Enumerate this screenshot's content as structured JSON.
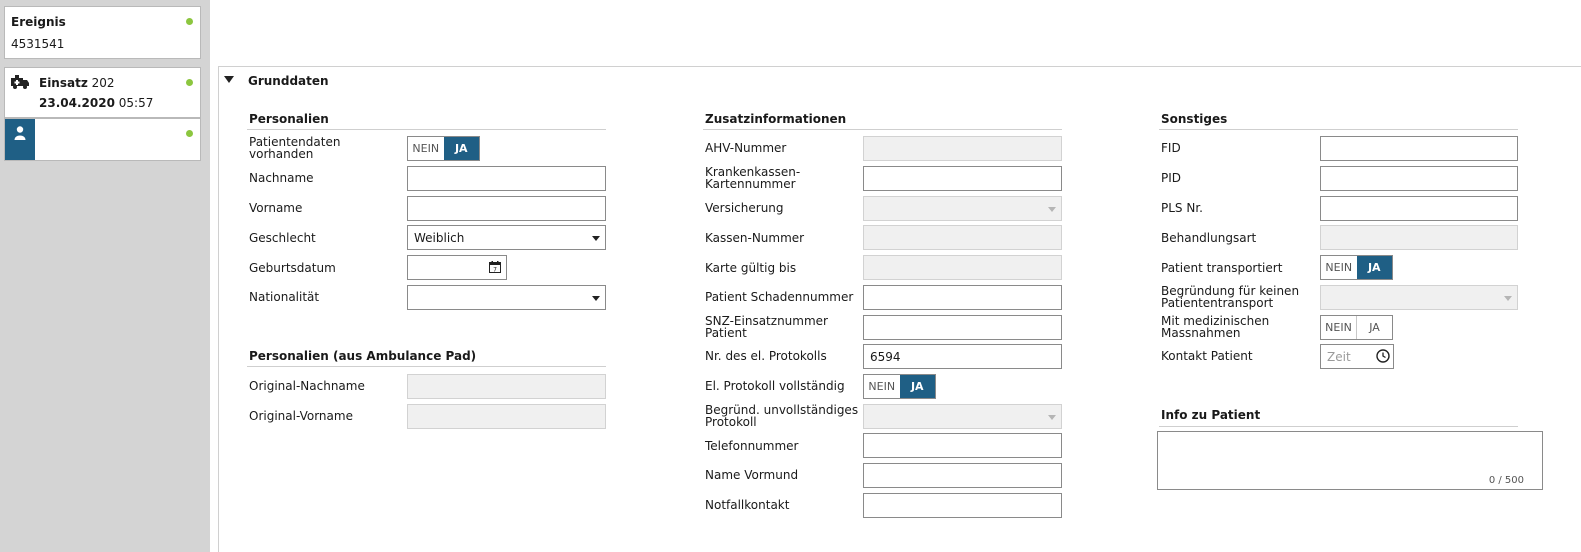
{
  "sidebar": {
    "ereignis": {
      "title": "Ereignis",
      "number": "4531541"
    },
    "einsatz": {
      "title": "Einsatz",
      "number": "202",
      "date": "23.04.2020",
      "time": "05:57"
    }
  },
  "section": {
    "title": "Grunddaten"
  },
  "personalien": {
    "header": "Personalien",
    "patientendaten_label_1": "Patientendaten",
    "patientendaten_label_2": "vorhanden",
    "toggle_no": "NEIN",
    "toggle_yes": "JA",
    "nachname_label": "Nachname",
    "nachname_value": "",
    "vorname_label": "Vorname",
    "vorname_value": "",
    "geschlecht_label": "Geschlecht",
    "geschlecht_value": "Weiblich",
    "geburtsdatum_label": "Geburtsdatum",
    "geburtsdatum_value": "",
    "nationalitaet_label": "Nationalität",
    "nationalitaet_value": ""
  },
  "ambulance_pad": {
    "header": "Personalien (aus Ambulance Pad)",
    "orig_nachname_label": "Original-Nachname",
    "orig_vorname_label": "Original-Vorname"
  },
  "zusatz": {
    "header": "Zusatzinformationen",
    "ahv_label": "AHV-Nummer",
    "kk_label_1": "Krankenkassen-",
    "kk_label_2": "Kartennummer",
    "versicherung_label": "Versicherung",
    "kassen_label": "Kassen-Nummer",
    "karte_label": "Karte gültig bis",
    "schaden_label": "Patient Schadennummer",
    "snz_label_1": "SNZ-Einsatznummer",
    "snz_label_2": "Patient",
    "protokoll_nr_label": "Nr. des el. Protokolls",
    "protokoll_nr_value": "6594",
    "protokoll_voll_label": "El. Protokoll vollständig",
    "begruend_label_1": "Begründ. unvollständiges",
    "begruend_label_2": "Protokoll",
    "telefon_label": "Telefonnummer",
    "vormund_label": "Name Vormund",
    "notfall_label": "Notfallkontakt"
  },
  "sonstiges": {
    "header": "Sonstiges",
    "fid_label": "FID",
    "pid_label": "PID",
    "pls_label": "PLS Nr.",
    "behandlung_label": "Behandlungsart",
    "transport_label": "Patient transportiert",
    "begr_transport_label_1": "Begründung für keinen",
    "begr_transport_label_2": "Patiententransport",
    "massnahmen_label_1": "Mit medizinischen",
    "massnahmen_label_2": "Massnahmen",
    "kontakt_label": "Kontakt Patient",
    "kontakt_placeholder": "Zeit"
  },
  "info": {
    "header": "Info zu Patient",
    "counter": "0 / 500"
  },
  "colors": {
    "accent": "#1f5f85",
    "status_dot": "#8cc63f",
    "sidebar_bg": "#d4d4d4"
  }
}
